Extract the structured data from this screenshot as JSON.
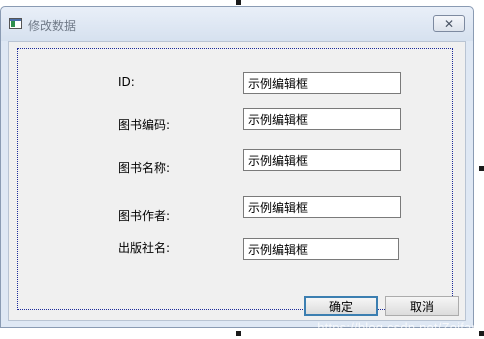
{
  "window": {
    "title": "修改数据",
    "close_symbol": "✕",
    "icon": "app-window-icon"
  },
  "form": {
    "fields": [
      {
        "label": "ID:",
        "value": "示例编辑框"
      },
      {
        "label": "图书编码:",
        "value": "示例编辑框"
      },
      {
        "label": "图书名称:",
        "value": "示例编辑框"
      },
      {
        "label": "图书作者:",
        "value": "示例编辑框"
      },
      {
        "label": "出版社名:",
        "value": "示例编辑框"
      }
    ]
  },
  "buttons": {
    "ok": "确定",
    "cancel": "取消"
  },
  "watermark": "https://blog.csdn.net/Zoifar"
}
